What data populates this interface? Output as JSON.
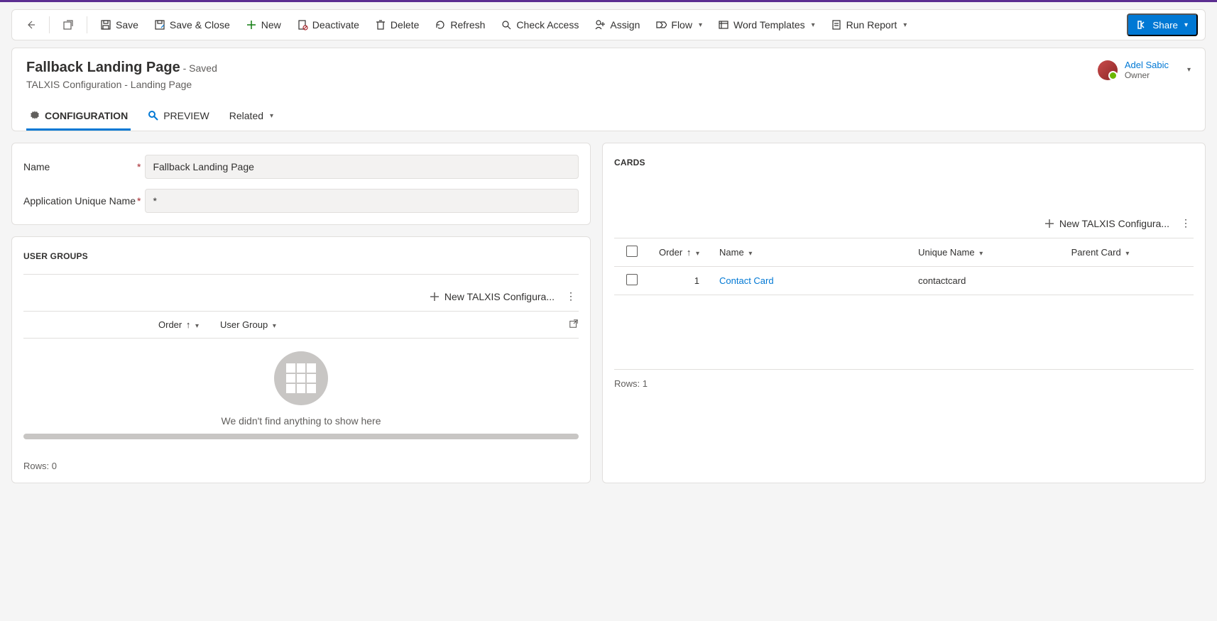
{
  "commandbar": {
    "save": "Save",
    "saveClose": "Save & Close",
    "new": "New",
    "deactivate": "Deactivate",
    "delete": "Delete",
    "refresh": "Refresh",
    "checkAccess": "Check Access",
    "assign": "Assign",
    "flow": "Flow",
    "wordTemplates": "Word Templates",
    "runReport": "Run Report",
    "share": "Share"
  },
  "header": {
    "title": "Fallback Landing Page",
    "saved": "- Saved",
    "subtitle": "TALXIS Configuration - Landing Page",
    "ownerName": "Adel Sabic",
    "ownerRole": "Owner"
  },
  "tabs": {
    "configuration": "CONFIGURATION",
    "preview": "PREVIEW",
    "related": "Related"
  },
  "form": {
    "nameLabel": "Name",
    "nameValue": "Fallback Landing Page",
    "appUniqueLabel": "Application Unique Name",
    "appUniqueValue": "*"
  },
  "userGroups": {
    "title": "USER GROUPS",
    "newAction": "New TALXIS Configura...",
    "colOrder": "Order",
    "colUserGroup": "User Group",
    "emptyMsg": "We didn't find anything to show here",
    "rows": "Rows: 0"
  },
  "cards": {
    "title": "CARDS",
    "newAction": "New TALXIS Configura...",
    "colOrder": "Order",
    "colName": "Name",
    "colUnique": "Unique Name",
    "colParent": "Parent Card",
    "rows": "Rows: 1",
    "row1": {
      "order": "1",
      "name": "Contact Card",
      "unique": "contactcard",
      "parent": ""
    }
  }
}
